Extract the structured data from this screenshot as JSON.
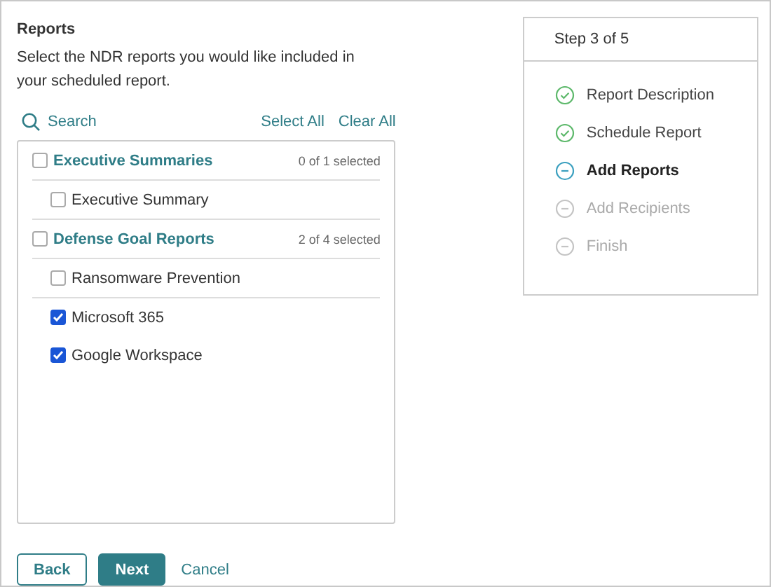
{
  "heading": "Reports",
  "description": "Select the NDR reports you would like included in your scheduled report.",
  "search": {
    "placeholder": "Search"
  },
  "actions": [
    "Select All",
    "Clear All"
  ],
  "groups": [
    {
      "label": "Executive Summaries",
      "checked": false,
      "count": "0 of 1 selected",
      "items": [
        {
          "label": "Executive Summary",
          "checked": false
        }
      ]
    },
    {
      "label": "Defense Goal Reports",
      "checked": false,
      "count": "2 of 4 selected",
      "items": [
        {
          "label": "Ransomware Prevention",
          "checked": false
        },
        {
          "label": "Microsoft 365",
          "checked": true
        },
        {
          "label": "Google Workspace",
          "checked": true
        }
      ]
    }
  ],
  "stepper": {
    "title": "Step 3 of 5",
    "steps": [
      {
        "label": "Report Description",
        "kind": "done"
      },
      {
        "label": "Schedule Report",
        "kind": "done"
      },
      {
        "label": "Add Reports",
        "kind": "current"
      },
      {
        "label": "Add Recipients",
        "kind": "pending"
      },
      {
        "label": "Finish",
        "kind": "pending"
      }
    ]
  },
  "buttons": {
    "back": "Back",
    "next": "Next",
    "cancel": "Cancel"
  }
}
